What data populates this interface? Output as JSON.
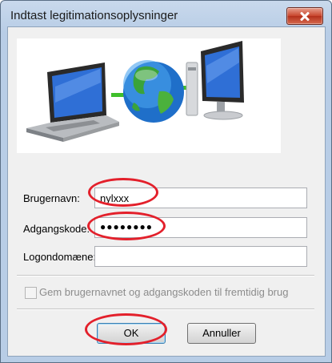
{
  "window": {
    "title": "Indtast legitimationsoplysninger"
  },
  "form": {
    "username_label": "Brugernavn:",
    "username_value": "nylxxx",
    "password_label": "Adgangskode:",
    "password_value": "●●●●●●●●",
    "domain_label": "Logondomæne:",
    "domain_value": "",
    "remember_label": "Gem brugernavnet og adgangskoden til fremtidig brug"
  },
  "buttons": {
    "ok": "OK",
    "cancel": "Annuller"
  },
  "colors": {
    "annotation_ring": "#e3202b",
    "screen_blue": "#2f6fd6",
    "link_green": "#3fbf2a"
  }
}
